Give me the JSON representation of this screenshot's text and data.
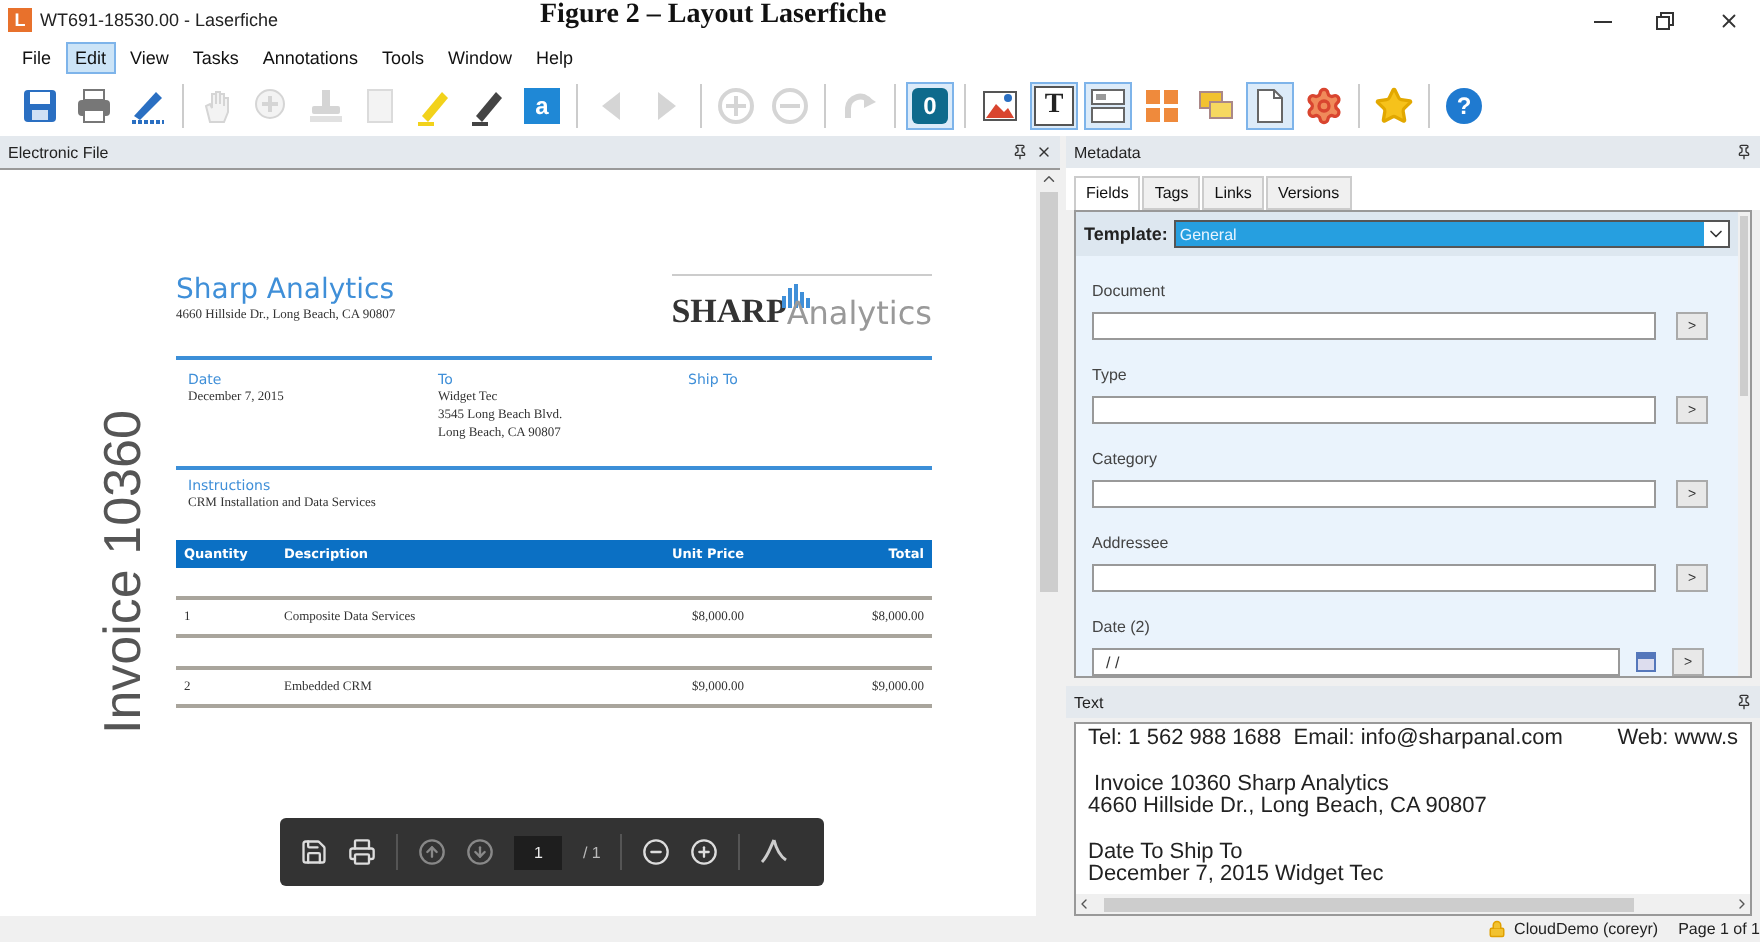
{
  "window": {
    "app_icon": "L",
    "title": "WT691-18530.00 - Laserfiche",
    "caption": "Figure 2 – Layout Laserfiche"
  },
  "menu": [
    {
      "label": "File",
      "selected": false
    },
    {
      "label": "Edit",
      "selected": true
    },
    {
      "label": "View",
      "selected": false
    },
    {
      "label": "Tasks",
      "selected": false
    },
    {
      "label": "Annotations",
      "selected": false
    },
    {
      "label": "Tools",
      "selected": false
    },
    {
      "label": "Window",
      "selected": false
    },
    {
      "label": "Help",
      "selected": false
    }
  ],
  "toolbar": [
    {
      "kind": "save",
      "disabled": false,
      "selected": false
    },
    {
      "kind": "print",
      "disabled": false,
      "selected": false
    },
    {
      "kind": "scan",
      "disabled": false,
      "selected": false
    },
    {
      "kind": "separator"
    },
    {
      "kind": "hand",
      "disabled": true,
      "selected": false
    },
    {
      "kind": "zoom",
      "disabled": true,
      "selected": false
    },
    {
      "kind": "stamp",
      "disabled": true,
      "selected": false
    },
    {
      "kind": "page",
      "disabled": true,
      "selected": false
    },
    {
      "kind": "highlighter",
      "disabled": false,
      "selected": false
    },
    {
      "kind": "pen",
      "disabled": false,
      "selected": false
    },
    {
      "kind": "letter",
      "label": "a",
      "disabled": false,
      "selected": false
    },
    {
      "kind": "separator"
    },
    {
      "kind": "prev",
      "disabled": true,
      "selected": false
    },
    {
      "kind": "next",
      "disabled": true,
      "selected": false
    },
    {
      "kind": "separator"
    },
    {
      "kind": "plus",
      "disabled": true,
      "selected": false
    },
    {
      "kind": "minus",
      "disabled": true,
      "selected": false
    },
    {
      "kind": "separator"
    },
    {
      "kind": "redo",
      "disabled": true,
      "selected": false
    },
    {
      "kind": "separator"
    },
    {
      "kind": "ocr",
      "label": "0",
      "disabled": false,
      "selected": true
    },
    {
      "kind": "separator"
    },
    {
      "kind": "image",
      "disabled": false,
      "selected": false
    },
    {
      "kind": "text",
      "label": "T",
      "disabled": false,
      "selected": true
    },
    {
      "kind": "layout",
      "disabled": false,
      "selected": true
    },
    {
      "kind": "thumbnails",
      "disabled": false,
      "selected": false
    },
    {
      "kind": "annotations",
      "disabled": false,
      "selected": false
    },
    {
      "kind": "pageview",
      "disabled": false,
      "selected": true
    },
    {
      "kind": "settings",
      "disabled": false,
      "selected": false
    },
    {
      "kind": "separator"
    },
    {
      "kind": "star",
      "disabled": false,
      "selected": false
    },
    {
      "kind": "separator"
    },
    {
      "kind": "help",
      "label": "?",
      "disabled": false,
      "selected": false
    }
  ],
  "electronic_file": {
    "title": "Electronic File",
    "invoice": {
      "vertical_title": "Invoice 10360",
      "company": "Sharp Analytics",
      "address": "4660 Hillside Dr., Long Beach, CA 90807",
      "logo_bold": "SHARP",
      "logo_light": "Analytics",
      "columns": [
        {
          "heading": "Date",
          "lines": [
            "December 7, 2015"
          ]
        },
        {
          "heading": "To",
          "lines": [
            "Widget Tec",
            "3545 Long Beach Blvd.",
            "Long Beach, CA 90807"
          ]
        },
        {
          "heading": "Ship To"
        }
      ],
      "instructions_heading": "Instructions",
      "instructions": "CRM Installation and Data Services",
      "table_header": [
        "Quantity",
        "Description",
        "Unit Price",
        "Total"
      ],
      "rows": [
        [
          "1",
          "Composite Data Services",
          "$8,000.00",
          "$8,000.00"
        ],
        [
          "2",
          "Embedded CRM",
          "$9,000.00",
          "$9,000.00"
        ]
      ]
    },
    "page_nav": {
      "page": "1",
      "total": "/ 1"
    }
  },
  "metadata": {
    "title": "Metadata",
    "tabs": [
      {
        "label": "Fields",
        "selected": true
      },
      {
        "label": "Tags",
        "selected": false
      },
      {
        "label": "Links",
        "selected": false
      },
      {
        "label": "Versions",
        "selected": false
      }
    ],
    "template_label": "Template:",
    "template_value": "General",
    "fields": [
      {
        "kind": "text",
        "label": "Document",
        "button": ">"
      },
      {
        "kind": "text",
        "label": "Type",
        "button": ">"
      },
      {
        "kind": "text",
        "label": "Category",
        "button": ">"
      },
      {
        "kind": "text",
        "label": "Addressee",
        "button": ">"
      },
      {
        "kind": "date",
        "label": "Date (2)",
        "value": "/ /",
        "button": ">"
      }
    ]
  },
  "text_pane": {
    "title": "Text",
    "paragraphs": [
      [
        {
          "left": "Tel: 1 562 988 1688  Email: info@sharpanal.com",
          "right": "Web: www.s"
        }
      ],
      [
        {
          "left": " Invoice 10360 Sharp Analytics"
        },
        {
          "left": "4660 Hillside Dr., Long Beach, CA 90807"
        }
      ],
      [
        {
          "left": "Date To Ship To"
        },
        {
          "left": "December 7, 2015 Widget Tec"
        }
      ]
    ]
  },
  "status_bar": {
    "user": "CloudDemo (coreyr)",
    "page": "Page 1 of 1"
  }
}
